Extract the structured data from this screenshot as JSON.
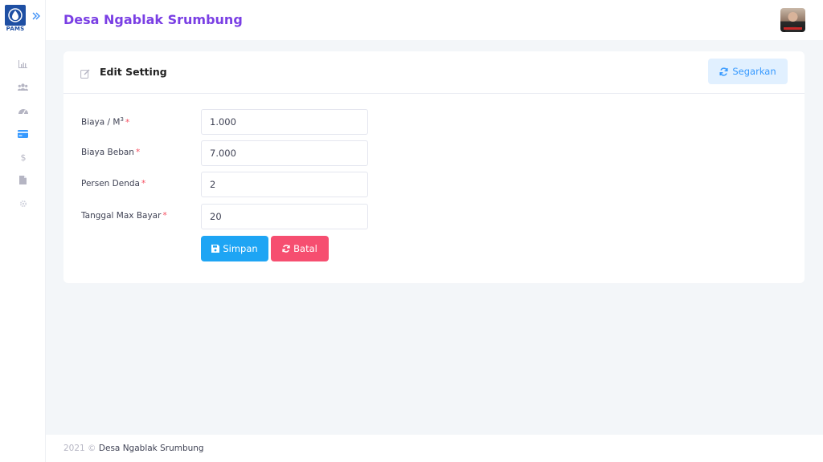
{
  "app": {
    "logo_text": "PAMS",
    "title": "Desa Ngablak Srumbung"
  },
  "sidebar": {
    "items": [
      {
        "icon": "chart-icon"
      },
      {
        "icon": "users-icon"
      },
      {
        "icon": "dashboard-icon"
      },
      {
        "icon": "card-icon",
        "active": true
      },
      {
        "icon": "dollar-icon"
      },
      {
        "icon": "file-icon"
      },
      {
        "icon": "gear-icon"
      }
    ]
  },
  "card": {
    "title": "Edit Setting",
    "refresh_label": "Segarkan"
  },
  "form": {
    "fields": [
      {
        "label": "Biaya / M",
        "sup": "3",
        "value": "1.000",
        "required": "*"
      },
      {
        "label": "Biaya Beban",
        "value": "7.000",
        "required": "*"
      },
      {
        "label": "Persen Denda",
        "value": "2",
        "required": "*"
      },
      {
        "label": "Tanggal Max Bayar",
        "value": "20",
        "required": "*"
      }
    ],
    "save_label": "Simpan",
    "cancel_label": "Batal"
  },
  "footer": {
    "year": "2021 ©",
    "brand": "Desa Ngablak Srumbung"
  },
  "colors": {
    "accent": "#3699ff",
    "title": "#7a3fe4",
    "save": "#1ea5f4",
    "cancel": "#f64e70",
    "required": "#f64e60"
  }
}
